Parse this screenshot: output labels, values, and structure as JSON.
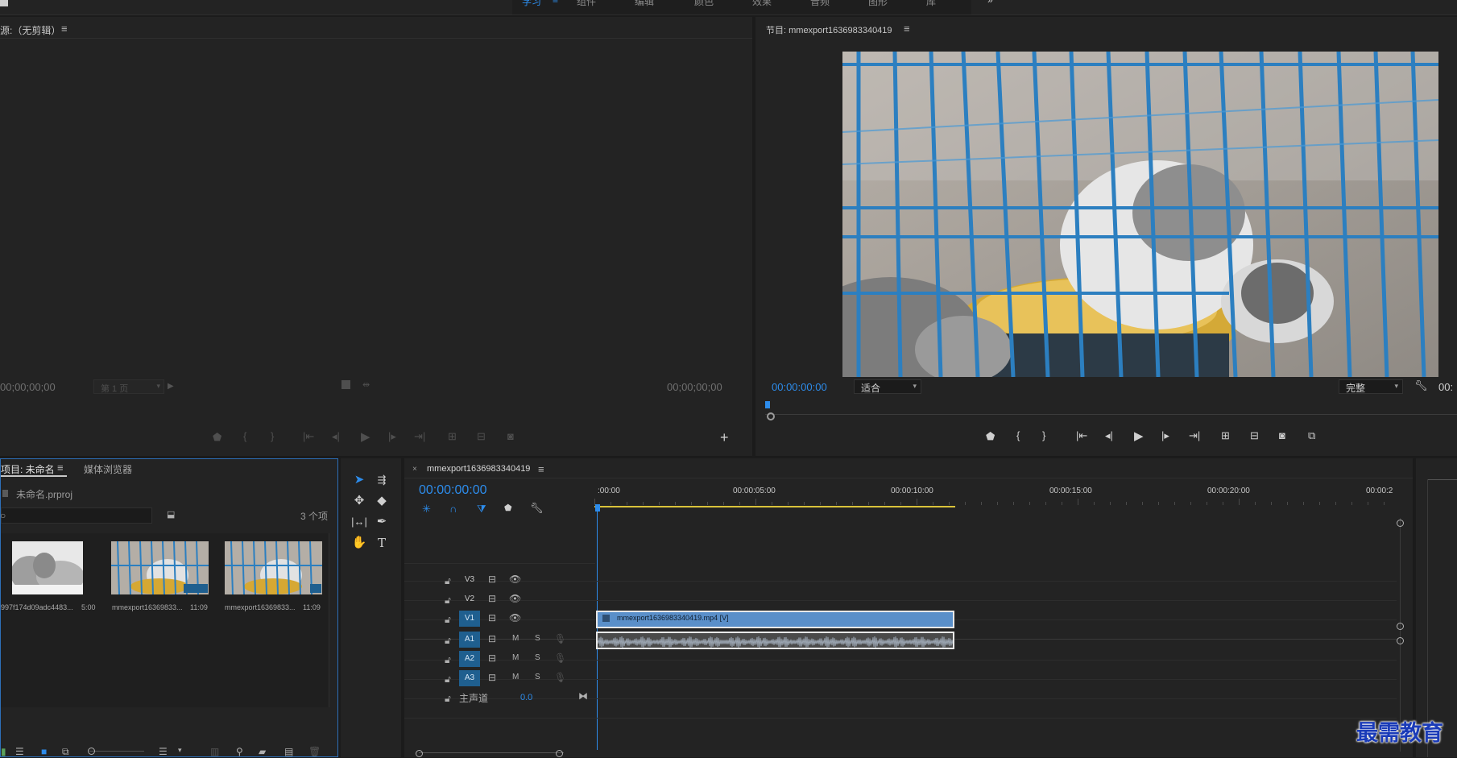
{
  "workspace_tabs": [
    "学习",
    "组件",
    "编辑",
    "颜色",
    "效果",
    "音频",
    "图形",
    "库"
  ],
  "source_monitor": {
    "title": "源:（无剪辑）",
    "timecode_left": "00;00;00;00",
    "page_select": "第 1 页",
    "timecode_right": "00;00;00;00"
  },
  "program_monitor": {
    "title": "节目: mmexport1636983340419",
    "timecode": "00:00:00:00",
    "fit_select": "适合",
    "quality_select": "完整",
    "timecode_right": "00:"
  },
  "project_panel": {
    "tab_project": "项目: 未命名",
    "tab_media": "媒体浏览器",
    "file_name": "未命名.prproj",
    "item_count": "3 个项",
    "items": [
      {
        "name": "997f174d09adc4483...",
        "duration": "5:00"
      },
      {
        "name": "mmexport16369833...",
        "duration": "11:09"
      },
      {
        "name": "mmexport16369833...",
        "duration": "11:09"
      }
    ]
  },
  "timeline": {
    "sequence_name": "mmexport1636983340419",
    "timecode": "00:00:00:00",
    "ruler_labels": [
      ":00:00",
      "00:00:05:00",
      "00:00:10:00",
      "00:00:15:00",
      "00:00:20:00",
      "00:00:2"
    ],
    "video_tracks": [
      "V3",
      "V2",
      "V1"
    ],
    "audio_tracks": [
      "A1",
      "A2",
      "A3"
    ],
    "master_label": "主声道",
    "master_value": "0.0",
    "mute_label": "M",
    "solo_label": "S",
    "clip_name": "mmexport1636983340419.mp4 [V]"
  },
  "watermark": "最需教育",
  "colors": {
    "accent": "#2d8ceb",
    "clip_blue": "#5a8fc9",
    "track_active": "#1f5f8f",
    "work_area": "#d9c23a",
    "panel_bg": "#232323",
    "app_bg": "#1b1b1b"
  }
}
